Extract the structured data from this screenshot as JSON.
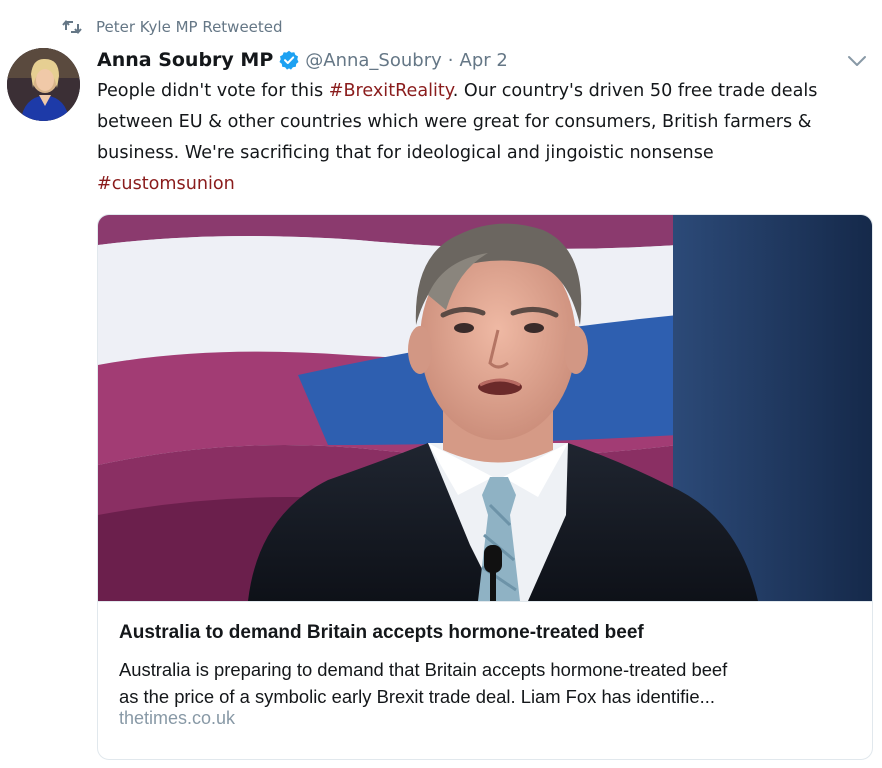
{
  "retweet": {
    "icon": "retweet-icon",
    "label": "Peter Kyle MP Retweeted"
  },
  "tweet": {
    "author": {
      "display_name": "Anna Soubry MP",
      "verified": true,
      "handle": "@Anna_Soubry",
      "avatar_icon": "avatar"
    },
    "separator": "·",
    "date": "Apr 2",
    "menu_icon": "chevron-down-icon",
    "text": {
      "line1_a": "People didn't vote for this ",
      "line1_hashtag": "#BrexitReality",
      "line1_b": ". Our country's driven 50 free trade deals",
      "line2": "between EU & other countries which were great for consumers, British farmers &",
      "line3": "business. We're sacrificing that for ideological and jingoistic nonsense",
      "line4_hashtag": "#customsunion"
    },
    "hashtag_color": "#8a1c1c"
  },
  "card": {
    "title": "Australia to demand Britain accepts hormone-treated beef",
    "description_line1": "Australia is preparing to demand that Britain accepts hormone-treated beef",
    "description_line2": "as the price of a symbolic early Brexit trade deal. Liam Fox has identifie...",
    "domain": "thetimes.co.uk"
  },
  "colors": {
    "text_primary": "#14171a",
    "text_secondary": "#657786",
    "verified_blue": "#1da1f2",
    "border": "#e1e8ed"
  }
}
